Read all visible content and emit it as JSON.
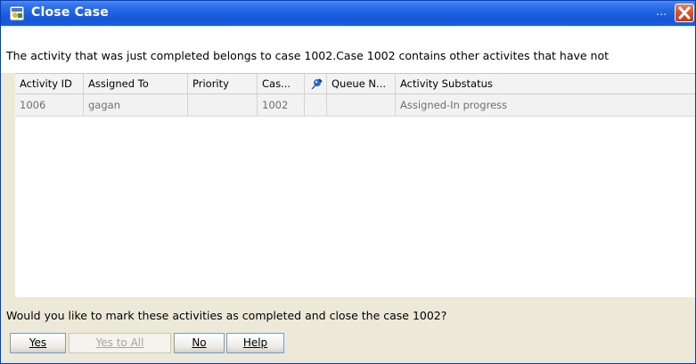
{
  "window": {
    "title": "Close Case",
    "overflow_indicator": "...",
    "icons": {
      "app": "case-window-icon",
      "close": "close-x-icon"
    }
  },
  "message": "The activity that was just completed belongs to case 1002.Case 1002 contains other activites that have not",
  "grid": {
    "columns": [
      "Activity ID",
      "Assigned To",
      "Priority",
      "Cas...",
      "",
      "Queue N...",
      "Activity Substatus"
    ],
    "pin_column_icon": "pushpin-icon",
    "rows": [
      [
        "1006",
        "gagan",
        "",
        "1002",
        "",
        "",
        "Assigned-In progress"
      ]
    ]
  },
  "question": "Would you like to mark these activities as completed and close the case 1002?",
  "buttons": {
    "yes": {
      "label": "Yes",
      "enabled": true
    },
    "yes_to_all": {
      "label": "Yes to All",
      "enabled": false
    },
    "no": {
      "label": "No",
      "enabled": true
    },
    "help": {
      "label": "Help",
      "enabled": true
    }
  },
  "colors": {
    "titlebar": "#1f63e3",
    "close_button": "#d8532f",
    "dialog_bg": "#ece9d8"
  }
}
